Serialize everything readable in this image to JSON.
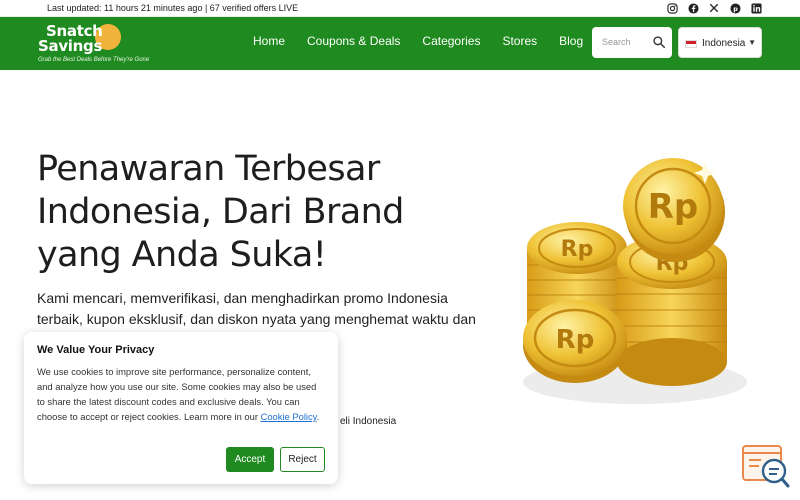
{
  "topbar": {
    "updated_text": "Last updated: 11 hours 21 minutes ago | 67 verified offers LIVE",
    "socials": [
      "instagram-icon",
      "facebook-icon",
      "x-icon",
      "pinterest-icon",
      "linkedin-icon"
    ]
  },
  "brand": {
    "line1": "Snatch",
    "line2": "Savings",
    "tagline": "Grab the Best Deals Before They're Gone"
  },
  "nav": {
    "items": [
      "Home",
      "Coupons & Deals",
      "Categories",
      "Stores",
      "Blog"
    ],
    "search_placeholder": "Search",
    "language": "Indonesia"
  },
  "hero": {
    "title": "Penawaran Terbesar Indonesia, Dari Brand yang Anda Suka!",
    "description": "Kami mencari, memverifikasi, dan menghadirkan promo Indonesia terbaik, kupon eksklusif, dan diskon nyata yang menghemat waktu dan uang Anda",
    "partial_text": "eli Indonesia",
    "coin_label": "Rp"
  },
  "cookie": {
    "title": "We Value Your Privacy",
    "body": "We use cookies to improve site performance, personalize content, and analyze how you use our site. Some cookies may also be used to share the latest discount codes and exclusive deals. You can choose to accept or reject cookies. Learn more in our ",
    "link": "Cookie Policy",
    "after_link": ".",
    "accept": "Accept",
    "reject": "Reject"
  },
  "colors": {
    "brand_green": "#1f8a1f",
    "accent_orange": "#f2b33d",
    "coin_gold": "#e9b52a"
  }
}
